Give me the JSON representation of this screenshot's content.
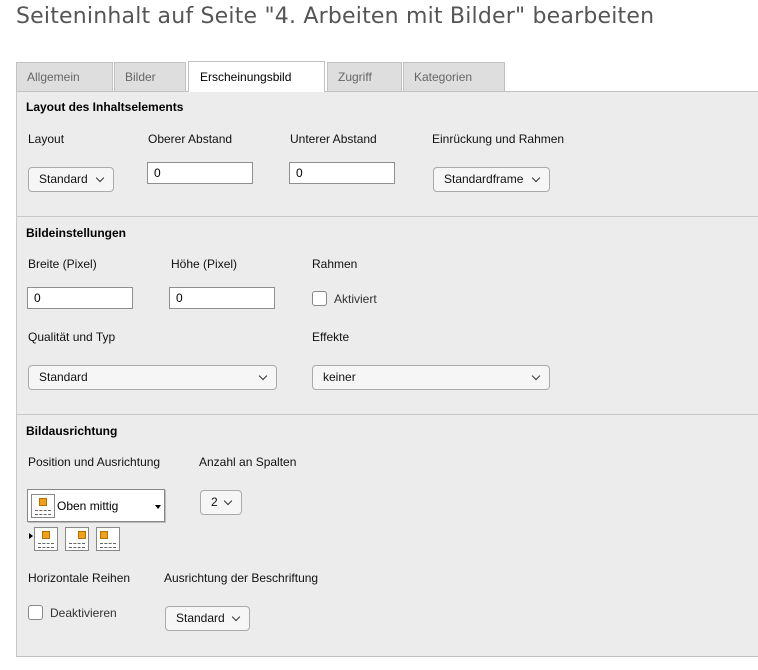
{
  "page": {
    "title": "Seiteninhalt auf Seite \"4. Arbeiten mit Bilder\" bearbeiten"
  },
  "tabs": [
    {
      "label": "Allgemein",
      "active": false
    },
    {
      "label": "Bilder",
      "active": false
    },
    {
      "label": "Erscheinungsbild",
      "active": true
    },
    {
      "label": "Zugriff",
      "active": false
    },
    {
      "label": "Kategorien",
      "active": false
    }
  ],
  "layout_section": {
    "title": "Layout des Inhaltselements",
    "layout_label": "Layout",
    "layout_value": "Standard",
    "space_before_label": "Oberer Abstand",
    "space_before_value": "0",
    "space_after_label": "Unterer Abstand",
    "space_after_value": "0",
    "frame_label": "Einrückung und Rahmen",
    "frame_value": "Standardframe"
  },
  "image_settings": {
    "title": "Bildeinstellungen",
    "width_label": "Breite (Pixel)",
    "width_value": "0",
    "height_label": "Höhe (Pixel)",
    "height_value": "0",
    "border_label": "Rahmen",
    "border_checkbox_label": "Aktiviert",
    "border_checked": false,
    "quality_label": "Qualität und Typ",
    "quality_value": "Standard",
    "effects_label": "Effekte",
    "effects_value": "keiner"
  },
  "image_alignment": {
    "title": "Bildausrichtung",
    "position_label": "Position und Ausrichtung",
    "position_value": "Oben mittig",
    "columns_label": "Anzahl an Spalten",
    "columns_value": "2",
    "rows_label": "Horizontale Reihen",
    "rows_checkbox_label": "Deaktivieren",
    "rows_checked": false,
    "caption_label": "Ausrichtung der Beschriftung",
    "caption_value": "Standard"
  },
  "colors": {
    "tab_bg": "#dedede",
    "panel_bg": "#ececec",
    "icon_accent": "#f0a020"
  }
}
